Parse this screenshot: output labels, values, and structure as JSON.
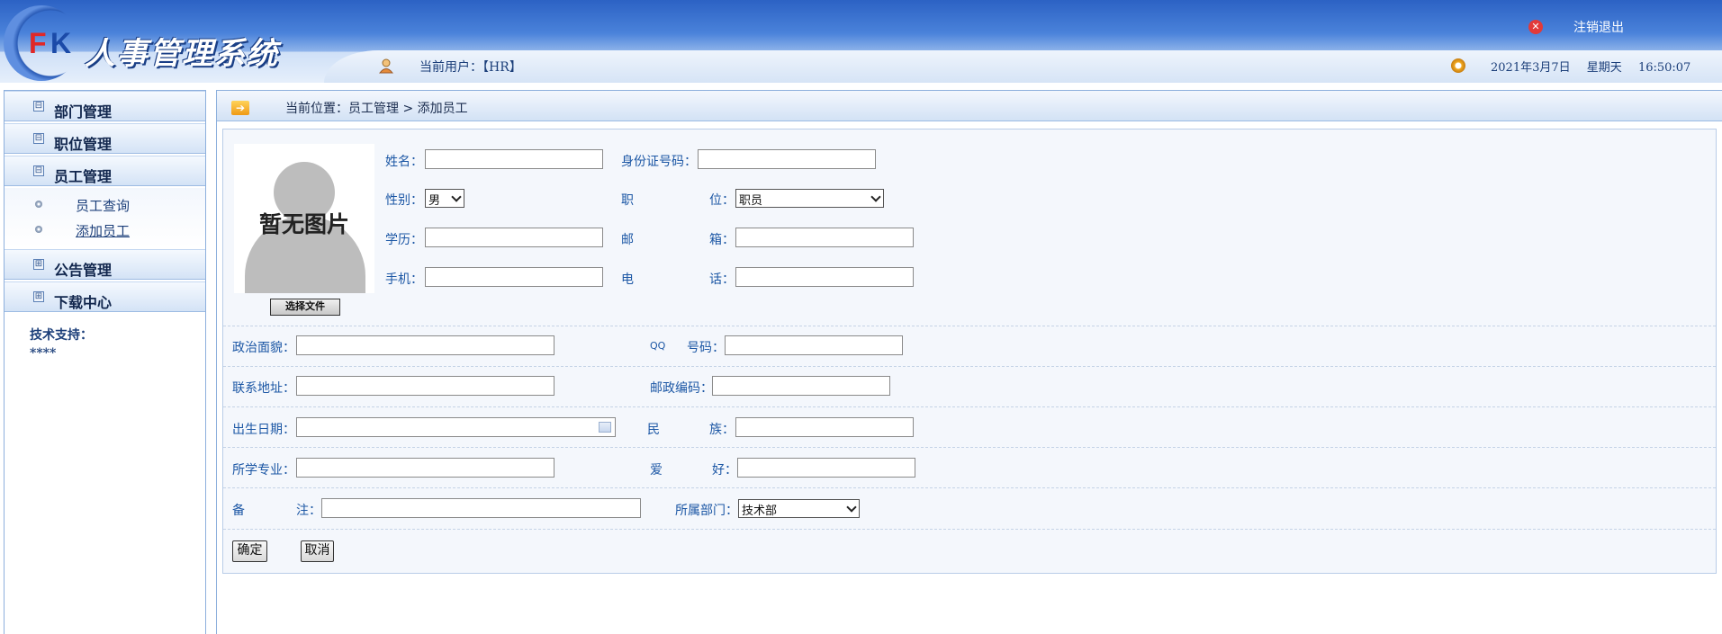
{
  "header": {
    "logo_letters": [
      "F",
      "K"
    ],
    "app_title": "人事管理系统",
    "current_user": "当前用户：【HR】",
    "logout_label": "注销退出",
    "date": "2021年3月7日",
    "weekday": "星期天",
    "time": "16:50:07"
  },
  "sidebar": {
    "menus": [
      {
        "label": "部门管理",
        "expander": "⊟"
      },
      {
        "label": "职位管理",
        "expander": "⊟"
      },
      {
        "label": "员工管理",
        "expander": "⊟"
      },
      {
        "label": "公告管理",
        "expander": "⊞"
      },
      {
        "label": "下载中心",
        "expander": "⊞"
      }
    ],
    "sub_items": [
      {
        "label": "员工查询"
      },
      {
        "label": "添加员工"
      }
    ],
    "support_label": "技术支持：",
    "support_value": "****"
  },
  "breadcrumb": {
    "text": "当前位置：员工管理 > 添加员工"
  },
  "photo": {
    "placeholder_text": "暂无图片",
    "file_button": "选择文件"
  },
  "form": {
    "name_label": "姓名：",
    "name_value": "",
    "idcard_label": "身份证号码：",
    "idcard_value": "",
    "sex_label": "性别：",
    "sex_value": "男",
    "job_label_a": "职",
    "job_label_b": "位：",
    "job_value": "职员",
    "education_label": "学历：",
    "education_value": "",
    "email_label_a": "邮",
    "email_label_b": "箱：",
    "email_value": "",
    "mobile_label": "手机：",
    "mobile_value": "",
    "phone_label_a": "电",
    "phone_label_b": "话：",
    "phone_value": "",
    "party_label": "政治面貌：",
    "party_value": "",
    "qq_label_a": "QQ",
    "qq_label_b": "号码：",
    "qq_value": "",
    "address_label": "联系地址：",
    "address_value": "",
    "postcode_label": "邮政编码：",
    "postcode_value": "",
    "birthday_label": "出生日期：",
    "birthday_value": "",
    "race_label_a": "民",
    "race_label_b": "族：",
    "race_value": "",
    "speciality_label": "所学专业：",
    "speciality_value": "",
    "hobby_label_a": "爱",
    "hobby_label_b": "好：",
    "hobby_value": "",
    "remark_label_a": "备",
    "remark_label_b": "注：",
    "remark_value": "",
    "dept_label": "所属部门：",
    "dept_value": "技术部",
    "submit_label": "确定",
    "cancel_label": "取消"
  }
}
